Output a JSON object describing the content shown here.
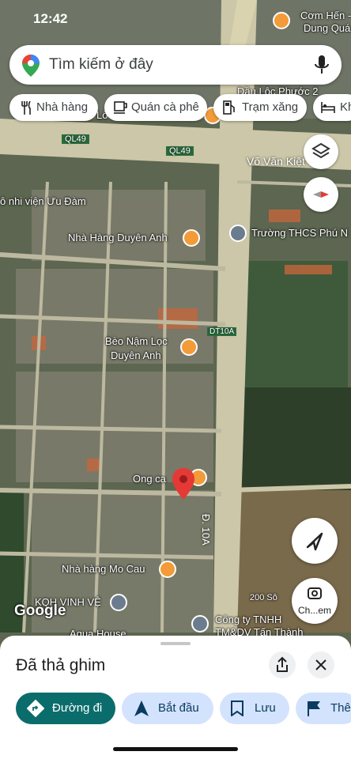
{
  "status": {
    "time": "12:42"
  },
  "search": {
    "placeholder": "Tìm kiếm ở đây"
  },
  "chips": [
    {
      "label": "Nhà hàng",
      "icon": "fork-knife-icon"
    },
    {
      "label": "Quán cà phê",
      "icon": "coffee-icon"
    },
    {
      "label": "Trạm xăng",
      "icon": "gas-pump-icon"
    },
    {
      "label": "Kh",
      "icon": "bed-icon"
    }
  ],
  "map": {
    "labels": {
      "cam_hen": "Cơm Hến -",
      "dung_qua": "Dung Quá",
      "dau_loc_phuoc": "Dầu Lộc Phước 2",
      "ql49_a": "QL49",
      "ql49_b": "QL49",
      "vo_van_kiet": "Võ Văn Kiệt",
      "nhi_vien": "ô nhi viện Ưu Đàm",
      "nha_hang_duyen_anh": "Nhà Hàng Duyên Anh",
      "truong_thcs": "Trường THCS Phú N",
      "dt10a": "DT10A",
      "beo_nam": "Bèo Nậm Lọc",
      "duyen_anh": "Duyên Anh",
      "ong_ca": "Ong ca",
      "d10a": "Đ. 10A",
      "mo_cau": "Nhà hàng Mo Cau",
      "kqh": "KQH VINH VỆ",
      "google": "Google",
      "scale": "200 Sô",
      "cong_ty_1": "Công ty TNHH",
      "cong_ty_2": "TM&DV Tấn Thành",
      "aqua": "Aqua House",
      "lo": "Lô"
    },
    "fab_label": "Ch...em"
  },
  "sheet": {
    "title": "Đã thả ghim",
    "actions": [
      {
        "label": "Đường đi",
        "icon": "directions-icon"
      },
      {
        "label": "Bắt đầu",
        "icon": "navigation-arrow-icon"
      },
      {
        "label": "Lưu",
        "icon": "bookmark-icon"
      },
      {
        "label": "Thê",
        "icon": "flag-icon"
      }
    ]
  },
  "colors": {
    "accent": "#0b57d0",
    "primary_button": "#0b6c6c",
    "chip_bg": "#ffffff",
    "action_bg": "#d3e3fd",
    "poi": "#f29b38",
    "pin": "#e53935"
  }
}
